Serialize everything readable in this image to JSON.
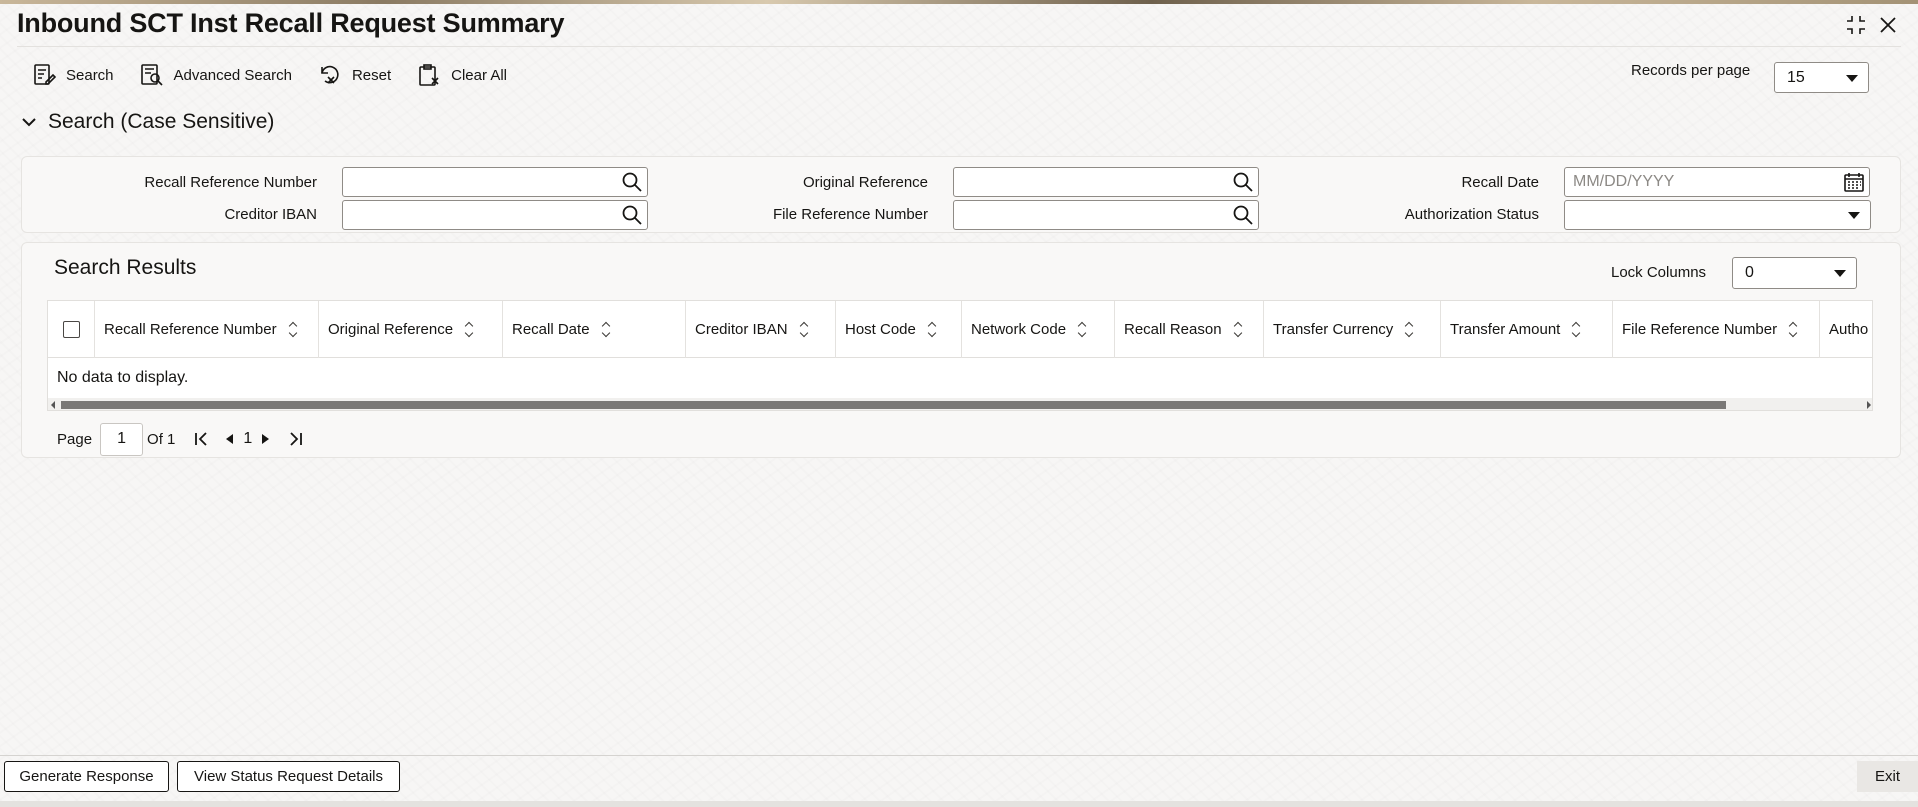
{
  "window": {
    "title": "Inbound SCT Inst Recall Request Summary"
  },
  "toolbar": {
    "search_label": "Search",
    "advanced_search_label": "Advanced Search",
    "reset_label": "Reset",
    "clear_all_label": "Clear All",
    "records_per_page_label": "Records per page",
    "records_per_page_value": "15"
  },
  "search_section": {
    "title": "Search (Case Sensitive)",
    "fields": {
      "recall_reference_number": {
        "label": "Recall Reference Number",
        "value": ""
      },
      "original_reference": {
        "label": "Original Reference",
        "value": ""
      },
      "recall_date": {
        "label": "Recall Date",
        "placeholder": "MM/DD/YYYY"
      },
      "creditor_iban": {
        "label": "Creditor IBAN",
        "value": ""
      },
      "file_reference_number": {
        "label": "File Reference Number",
        "value": ""
      },
      "authorization_status": {
        "label": "Authorization Status",
        "value": ""
      }
    }
  },
  "results": {
    "title": "Search Results",
    "lock_columns_label": "Lock Columns",
    "lock_columns_value": "0",
    "columns": [
      "Recall Reference Number",
      "Original Reference",
      "Recall Date",
      "Creditor IBAN",
      "Host Code",
      "Network Code",
      "Recall Reason",
      "Transfer Currency",
      "Transfer Amount",
      "File Reference Number",
      "Autho"
    ],
    "empty_message": "No data to display."
  },
  "pagination": {
    "page_label": "Page",
    "current_page": "1",
    "of_label": "Of 1",
    "page_link": "1"
  },
  "footer": {
    "generate_response_label": "Generate Response",
    "view_status_label": "View Status Request Details",
    "exit_label": "Exit"
  },
  "icons": {
    "maximize": "maximize-icon",
    "close": "close-icon",
    "search": "search-icon",
    "calendar": "calendar-icon"
  }
}
